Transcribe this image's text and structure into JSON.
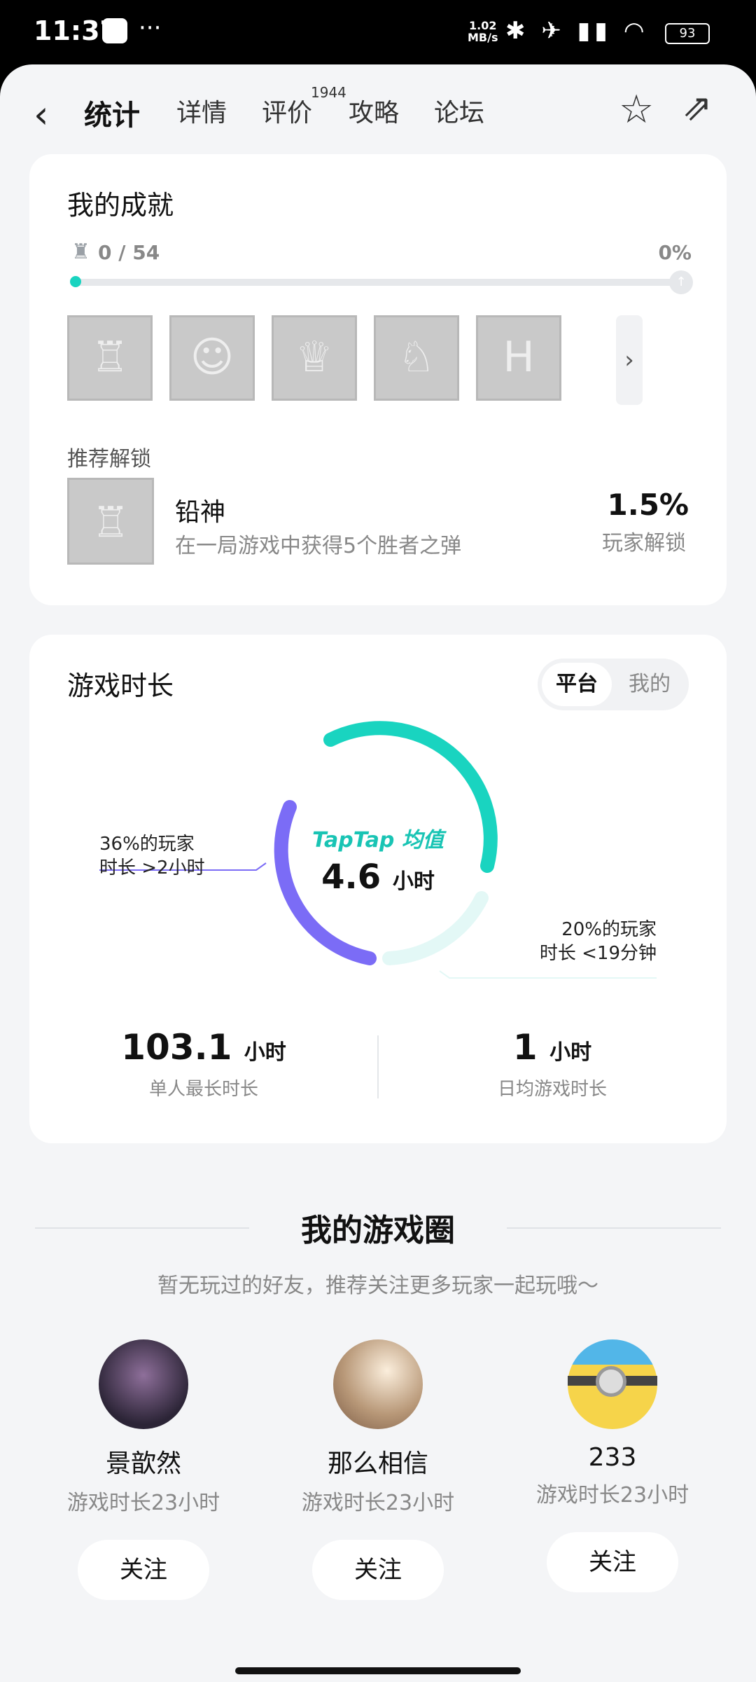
{
  "status_bar": {
    "time": "11:37",
    "dots": "···",
    "net_speed": "1.02",
    "net_unit": "MB/s",
    "icons": "✱ ✈ ▮▮ ◠",
    "battery": "93"
  },
  "nav": {
    "tabs": [
      {
        "label": "统计",
        "active": true
      },
      {
        "label": "详情",
        "active": false
      },
      {
        "label": "评价",
        "active": false
      },
      {
        "label": "攻略",
        "active": false
      },
      {
        "label": "论坛",
        "active": false
      }
    ],
    "review_badge": "1944"
  },
  "achievements": {
    "title": "我的成就",
    "count": "0 / 54",
    "percent": "0%",
    "progress": 0.0,
    "recommend_label": "推荐解锁",
    "recommend": {
      "name": "铅神",
      "desc": "在一局游戏中获得5个胜者之弹",
      "percent": "1.5%",
      "sub": "玩家解锁"
    }
  },
  "playtime": {
    "title": "游戏时长",
    "toggle": [
      "平台",
      "我的"
    ],
    "center_brand": "TapTap 均值",
    "center_value": "4.6",
    "center_unit": "小时",
    "callout_left": [
      "36%的玩家",
      "时长 >2小时"
    ],
    "callout_right": [
      "20%的玩家",
      "时长 <19分钟"
    ],
    "stats": [
      {
        "value": "103.1",
        "unit": "小时",
        "label": "单人最长时长"
      },
      {
        "value": "1",
        "unit": "小时",
        "label": "日均游戏时长"
      }
    ],
    "colors": {
      "teal": "#19d4c0",
      "purple": "#7b6cf6",
      "light": "#e3f8f6"
    }
  },
  "game_circle": {
    "title": "我的游戏圈",
    "subtitle": "暂无玩过的好友，推荐关注更多玩家一起玩哦～",
    "friends": [
      {
        "name": "景歆然",
        "time": "游戏时长23小时",
        "follow": "关注"
      },
      {
        "name": "那么相信",
        "time": "游戏时长23小时",
        "follow": "关注"
      },
      {
        "name": "233",
        "time": "游戏时长23小时",
        "follow": "关注"
      }
    ]
  }
}
